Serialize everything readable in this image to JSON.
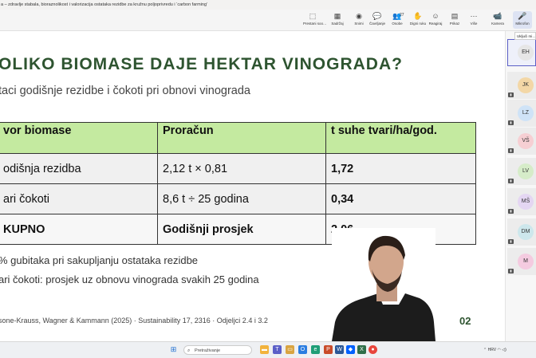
{
  "window": {
    "title": "a – zdravlje stabala, bioraznolikost i valorizacija ostataka rezidbe za kružnu poljoprivredu i ‘carbon farming’"
  },
  "toolbar": {
    "items": [
      {
        "name": "share-screen",
        "label": "Prestani soo…",
        "icon": "⬚"
      },
      {
        "name": "content",
        "label": "Sadržaj",
        "icon": "▦"
      },
      {
        "name": "leave-stop",
        "label": "Snimi",
        "icon": "◉"
      },
      {
        "name": "chat",
        "label": "Čavrljanje",
        "icon": "💬"
      },
      {
        "name": "people",
        "label": "Osobe",
        "icon": "👥",
        "badge": "27"
      },
      {
        "name": "raise-hand",
        "label": "Digni ruku",
        "icon": "✋"
      },
      {
        "name": "react",
        "label": "Reagiraj",
        "icon": "☺"
      },
      {
        "name": "view",
        "label": "Prikaz",
        "icon": "▤"
      },
      {
        "name": "more",
        "label": "Više",
        "icon": "⋯"
      },
      {
        "name": "camera",
        "label": "Kamera",
        "icon": "📹"
      },
      {
        "name": "mic",
        "label": "Mikrofon",
        "icon": "🎤"
      }
    ]
  },
  "tooltip": "Uključi mi…",
  "slide": {
    "title": "OLIKO BIOMASE DAJE HEKTAR VINOGRADA?",
    "subtitle": "taci godišnje rezidbe i čokoti pri obnovi vinograda",
    "table": {
      "headers": [
        "vor biomase",
        "Proračun",
        "t suhe tvari/ha/god."
      ],
      "rows": [
        [
          "odišnja rezidba",
          "2,12 t × 0,81",
          "1,72"
        ],
        [
          "ari čokoti",
          "8,6 t ÷ 25 godina",
          "0,34"
        ]
      ],
      "total": [
        "KUPNO",
        "Godišnji prosjek",
        "2,06"
      ]
    },
    "bullets": [
      "% gubitaka pri sakupljanju ostataka rezidbe",
      "ari čokoti: prosjek uz obnovu vinograda svakih 25 godina"
    ],
    "reference": "sone-Krauss, Wagner & Kammann (2025) · Sustainability 17, 2316 · Odjeljci 2.4 i 3.2",
    "number": "02"
  },
  "participants": [
    {
      "initials": "EH",
      "color": "#e6e6e6",
      "active": true
    },
    {
      "initials": "JK",
      "color": "#f3d7a6"
    },
    {
      "initials": "LZ",
      "color": "#cfe3f7"
    },
    {
      "initials": "VŠ",
      "color": "#f6cfd3"
    },
    {
      "initials": "LV",
      "color": "#d6ecc9"
    },
    {
      "initials": "MŠ",
      "color": "#e4d6f2"
    },
    {
      "initials": "DM",
      "color": "#cde7ec"
    },
    {
      "initials": "M",
      "color": "#f4cbe0"
    }
  ],
  "taskbar": {
    "search_placeholder": "Pretraživanje",
    "language": "HRV"
  }
}
